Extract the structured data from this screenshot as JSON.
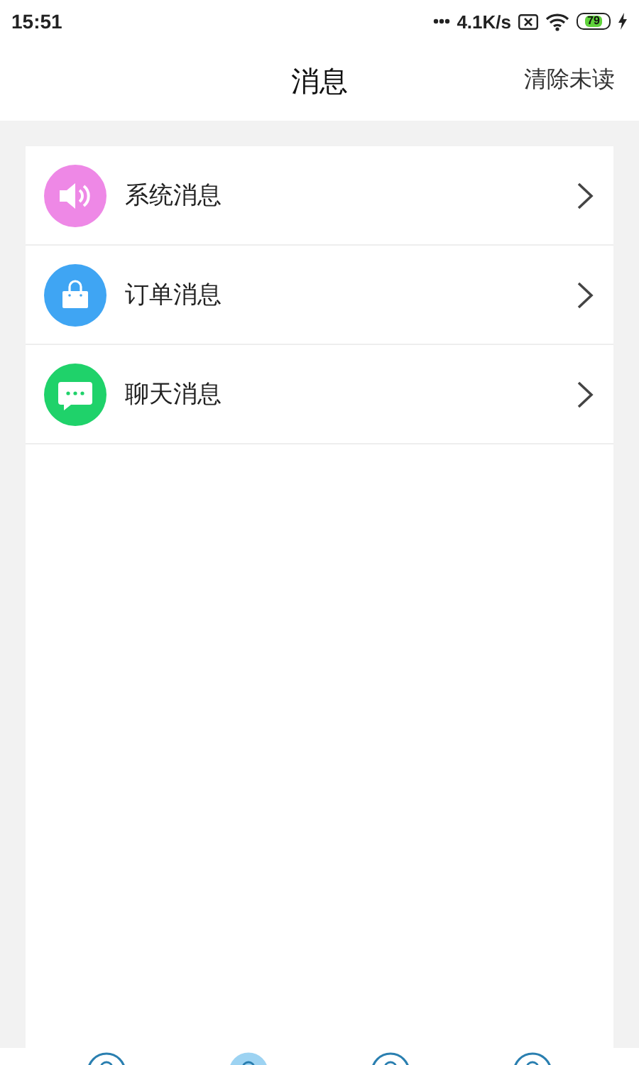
{
  "status_bar": {
    "time": "15:51",
    "network_speed": "4.1K/s",
    "battery": "79"
  },
  "header": {
    "title": "消息",
    "action": "清除未读"
  },
  "items": [
    {
      "label": "系统消息",
      "kind": "speaker",
      "color": "#ee88e6"
    },
    {
      "label": "订单消息",
      "kind": "bag",
      "color": "#3fa5f3"
    },
    {
      "label": "聊天消息",
      "kind": "chat",
      "color": "#1fd26a"
    }
  ],
  "bottom_nav": {
    "tabs": [
      {
        "selected": false
      },
      {
        "selected": true
      },
      {
        "selected": false
      },
      {
        "selected": false
      }
    ]
  }
}
